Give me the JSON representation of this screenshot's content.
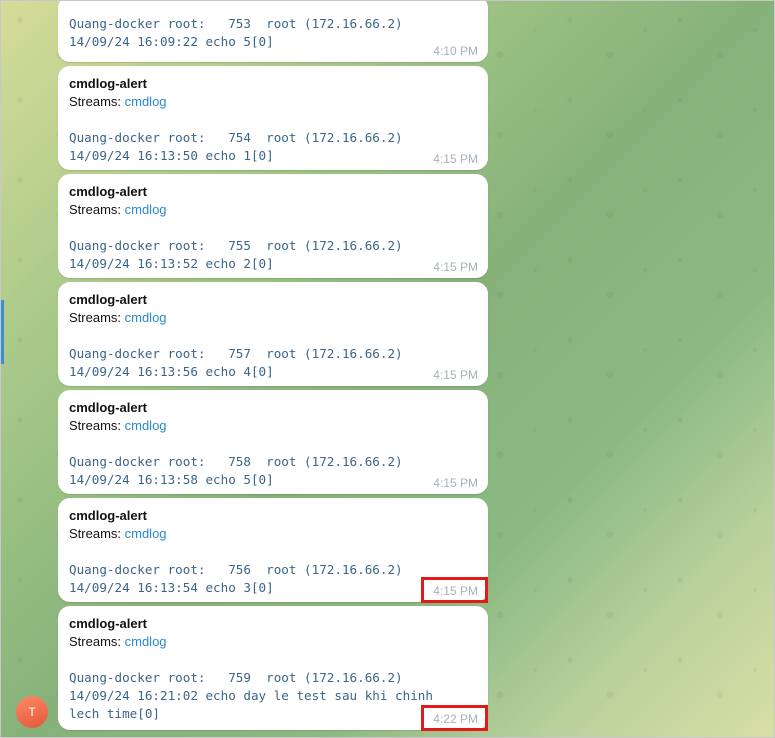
{
  "messages": [
    {
      "sender": "",
      "streams_label": "",
      "streams_link": "",
      "lines": [
        "Quang-docker root:   753  root (172.16.66.2)",
        "14/09/24 16:09:22 echo 5[0]"
      ],
      "time": "4:10 PM"
    },
    {
      "sender": "cmdlog-alert",
      "streams_label": "Streams: ",
      "streams_link": "cmdlog",
      "lines": [
        "Quang-docker root:   754  root (172.16.66.2)",
        "14/09/24 16:13:50 echo 1[0]"
      ],
      "time": "4:15 PM"
    },
    {
      "sender": "cmdlog-alert",
      "streams_label": "Streams: ",
      "streams_link": "cmdlog",
      "lines": [
        "Quang-docker root:   755  root (172.16.66.2)",
        "14/09/24 16:13:52 echo 2[0]"
      ],
      "time": "4:15 PM"
    },
    {
      "sender": "cmdlog-alert",
      "streams_label": "Streams: ",
      "streams_link": "cmdlog",
      "lines": [
        "Quang-docker root:   757  root (172.16.66.2)",
        "14/09/24 16:13:56 echo 4[0]"
      ],
      "time": "4:15 PM"
    },
    {
      "sender": "cmdlog-alert",
      "streams_label": "Streams: ",
      "streams_link": "cmdlog",
      "lines": [
        "Quang-docker root:   758  root (172.16.66.2)",
        "14/09/24 16:13:58 echo 5[0]"
      ],
      "time": "4:15 PM"
    },
    {
      "sender": "cmdlog-alert",
      "streams_label": "Streams: ",
      "streams_link": "cmdlog",
      "lines": [
        "Quang-docker root:   756  root (172.16.66.2)",
        "14/09/24 16:13:54 echo 3[0]"
      ],
      "time": "4:15 PM"
    },
    {
      "sender": "cmdlog-alert",
      "streams_label": "Streams: ",
      "streams_link": "cmdlog",
      "lines": [
        "Quang-docker root:   759  root (172.16.66.2)",
        "14/09/24 16:21:02 echo day le test sau khi chinh",
        "lech time[0]"
      ],
      "time": "4:22 PM"
    }
  ],
  "avatar": {
    "initial": "T"
  },
  "colors": {
    "bubble": "#ffffff",
    "code_text": "#3d6489",
    "link": "#2a8bc8",
    "timestamp": "#a6b1b8",
    "highlight_border": "#e21a1a",
    "avatar": "#e0583a"
  }
}
